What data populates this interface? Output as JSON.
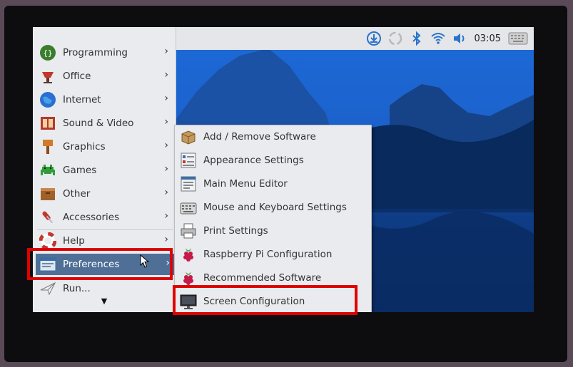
{
  "panel": {
    "clock": "03:05",
    "tray_icons": [
      "download-icon",
      "network-spinner-icon",
      "bluetooth-icon",
      "wifi-icon",
      "volume-icon",
      "keyboard-icon"
    ]
  },
  "menu": {
    "items": [
      {
        "label": "Programming",
        "icon": "programming-icon"
      },
      {
        "label": "Office",
        "icon": "office-icon"
      },
      {
        "label": "Internet",
        "icon": "internet-icon"
      },
      {
        "label": "Sound & Video",
        "icon": "sound-video-icon"
      },
      {
        "label": "Graphics",
        "icon": "graphics-icon"
      },
      {
        "label": "Games",
        "icon": "games-icon"
      },
      {
        "label": "Other",
        "icon": "other-icon"
      },
      {
        "label": "Accessories",
        "icon": "accessories-icon"
      },
      {
        "label": "Help",
        "icon": "help-icon"
      },
      {
        "label": "Preferences",
        "icon": "preferences-icon",
        "selected": true
      },
      {
        "label": "Run...",
        "icon": "run-icon"
      }
    ]
  },
  "submenu": {
    "items": [
      {
        "label": "Add / Remove Software",
        "icon": "package-icon"
      },
      {
        "label": "Appearance Settings",
        "icon": "appearance-icon"
      },
      {
        "label": "Main Menu Editor",
        "icon": "menu-editor-icon"
      },
      {
        "label": "Mouse and Keyboard Settings",
        "icon": "mouse-keyboard-icon"
      },
      {
        "label": "Print Settings",
        "icon": "printer-icon"
      },
      {
        "label": "Raspberry Pi Configuration",
        "icon": "raspberry-icon"
      },
      {
        "label": "Recommended Software",
        "icon": "raspberry-icon"
      },
      {
        "label": "Screen Configuration",
        "icon": "monitor-icon"
      }
    ]
  },
  "colors": {
    "highlight": "#e00000",
    "selection": "#4f6f96",
    "menu_bg": "#e9ebee"
  }
}
